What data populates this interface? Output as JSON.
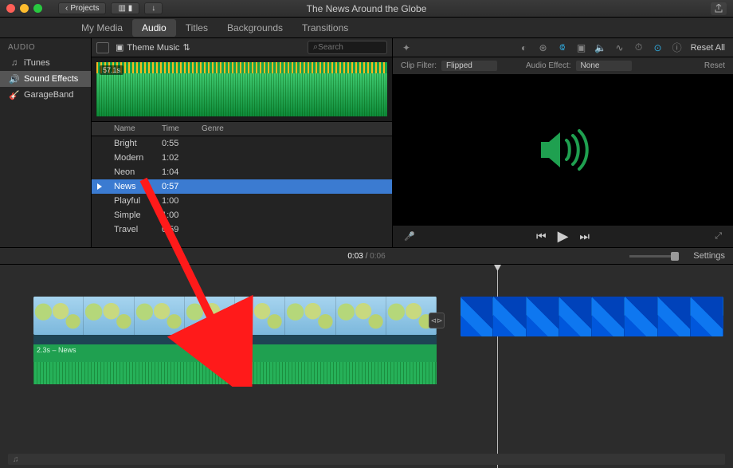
{
  "titlebar": {
    "title": "The News Around the Globe",
    "back_label": "Projects"
  },
  "tabs": {
    "items": [
      "My Media",
      "Audio",
      "Titles",
      "Backgrounds",
      "Transitions"
    ],
    "active_index": 1
  },
  "sidebar": {
    "header": "AUDIO",
    "items": [
      {
        "label": "iTunes",
        "icon": "music-note-icon"
      },
      {
        "label": "Sound Effects",
        "icon": "speaker-icon",
        "selected": true
      },
      {
        "label": "GarageBand",
        "icon": "guitar-icon"
      }
    ]
  },
  "browser": {
    "library_label": "Theme Music",
    "search_placeholder": "Search",
    "preview_badge": "57.1s",
    "columns": [
      "Name",
      "Time",
      "Genre"
    ],
    "rows": [
      {
        "name": "Bright",
        "time": "0:55"
      },
      {
        "name": "Modern",
        "time": "1:02"
      },
      {
        "name": "Neon",
        "time": "1:04"
      },
      {
        "name": "News",
        "time": "0:57",
        "selected": true
      },
      {
        "name": "Playful",
        "time": "1:00"
      },
      {
        "name": "Simple",
        "time": "1:00"
      },
      {
        "name": "Travel",
        "time": "0:59"
      }
    ]
  },
  "viewer": {
    "clip_filter_label": "Clip Filter:",
    "clip_filter_value": "Flipped",
    "audio_effect_label": "Audio Effect:",
    "audio_effect_value": "None",
    "reset_all": "Reset All",
    "reset": "Reset"
  },
  "timeline": {
    "current": "0:03",
    "duration": "0:06",
    "settings": "Settings",
    "audio_clip_label": "2.3s – News"
  },
  "bottom": {
    "note": "♫"
  }
}
